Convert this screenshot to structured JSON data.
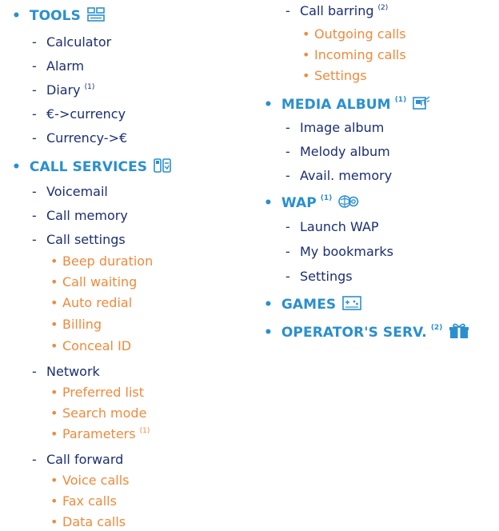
{
  "col1": {
    "tools": {
      "title": "TOOLS",
      "items": [
        "Calculator",
        "Alarm",
        "Diary",
        "€->currency",
        "Currency->€"
      ],
      "diary_note": "(1)"
    },
    "call_services": {
      "title": "CALL SERVICES",
      "voicemail": "Voicemail",
      "call_memory": "Call memory",
      "call_settings": "Call settings",
      "call_settings_subs": [
        "Beep duration",
        "Call waiting",
        "Auto redial",
        "Billing",
        "Conceal ID"
      ],
      "network": "Network",
      "network_subs": [
        "Preferred list",
        "Search mode",
        "Parameters"
      ],
      "parameters_note": "(1)",
      "call_forward": "Call forward",
      "call_forward_subs": [
        "Voice calls",
        "Fax calls",
        "Data calls"
      ]
    }
  },
  "col2": {
    "call_barring": "Call barring",
    "call_barring_note": "(2)",
    "call_barring_subs": [
      "Outgoing calls",
      "Incoming calls",
      "Settings"
    ],
    "media_album": {
      "title": "MEDIA ALBUM",
      "note": "(1)",
      "items": [
        "Image album",
        "Melody album",
        "Avail. memory"
      ]
    },
    "wap": {
      "title": "WAP",
      "note": "(1)",
      "items": [
        "Launch WAP",
        "My bookmarks",
        "Settings"
      ]
    },
    "games": {
      "title": "GAMES"
    },
    "operator": {
      "title": "OPERATOR'S SERV.",
      "note": "(2)"
    }
  },
  "bullets": {
    "dash": "-",
    "dot": "•"
  },
  "colors": {
    "heading": "#2a8fd0",
    "item": "#1b2e72",
    "subitem": "#ee8a3c"
  },
  "icons": [
    "tools-icon",
    "call-services-icon",
    "media-album-icon",
    "wap-icon",
    "games-icon",
    "operator-gift-icon"
  ]
}
